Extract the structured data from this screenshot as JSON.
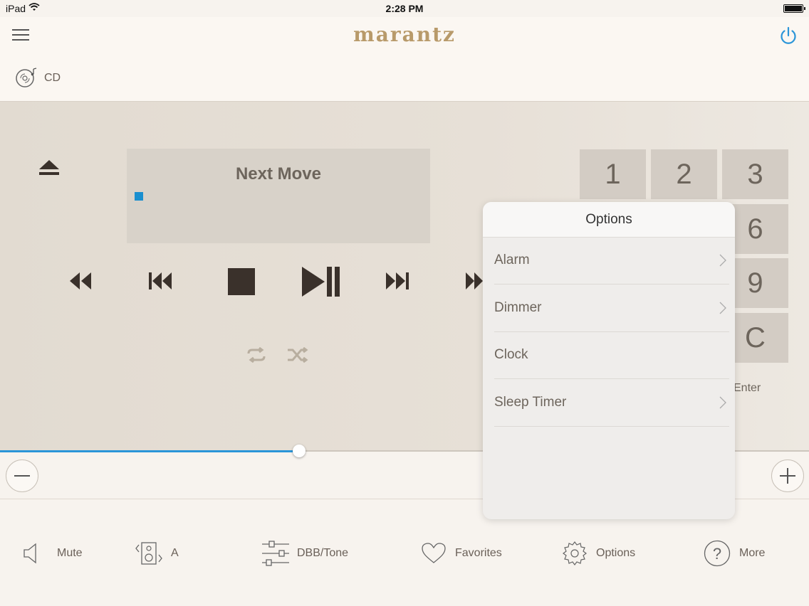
{
  "status_bar": {
    "carrier": "iPad",
    "time": "2:28 PM"
  },
  "header": {
    "brand": "marantz",
    "source_label": "CD"
  },
  "player": {
    "track_title": "Next Move"
  },
  "keypad": {
    "keys": [
      "1",
      "2",
      "3",
      "6",
      "9",
      "C"
    ],
    "enter_label": "Enter"
  },
  "volume": {
    "level_fraction": 0.37
  },
  "bottom_bar": {
    "mute": "Mute",
    "speaker": "A",
    "dbb_tone": "DBB/Tone",
    "favorites": "Favorites",
    "options": "Options",
    "more": "More"
  },
  "options_popover": {
    "title": "Options",
    "items": [
      {
        "label": "Alarm",
        "chevron": true
      },
      {
        "label": "Dimmer",
        "chevron": true
      },
      {
        "label": "Clock",
        "chevron": false
      },
      {
        "label": "Sleep Timer",
        "chevron": true
      }
    ]
  },
  "colors": {
    "accent_blue": "#2a95d8",
    "brand_gold": "#b89a6a",
    "indicator": "#1a8fcf"
  }
}
